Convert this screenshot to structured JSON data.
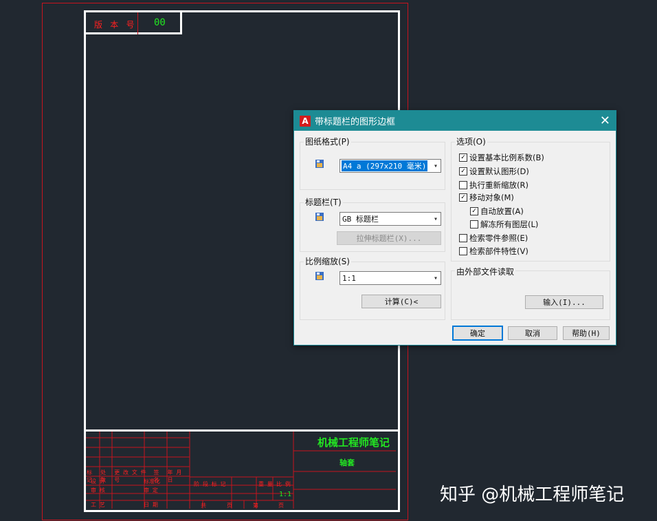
{
  "drawing": {
    "version_label": "版 本 号",
    "version_value": "00",
    "company": "机械工程师笔记",
    "part_name": "轴套",
    "scale_value": "1:1",
    "row1_labels": [
      "标 记",
      "处 数",
      "更 改 文 件 号",
      "签 名",
      "年 月 日"
    ],
    "row2_labels": [
      "设 计",
      "标准化"
    ],
    "row3_labels": [
      "审 核",
      "审 定"
    ],
    "row4_labels": [
      "工 艺",
      "日 期"
    ],
    "stage_headers": [
      "阶 段 标 记",
      "重 量",
      "比 例"
    ],
    "bottom_labels": [
      "共",
      "页",
      "第",
      "页"
    ]
  },
  "watermark": "知乎 @机械工程师笔记",
  "dialog": {
    "title": "带标题栏的图形边框",
    "close_glyph": "✕",
    "paper_format": {
      "label": "图纸格式(P)",
      "value": "A4 a (297x210 毫米)"
    },
    "title_block": {
      "label": "标题栏(T)",
      "value": "GB 标题栏",
      "stretch_button": "拉伸标题栏(X)..."
    },
    "scale": {
      "label": "比例缩放(S)",
      "value": "1:1",
      "calc_button": "计算(C)<"
    },
    "options": {
      "label": "选项(O)",
      "items": [
        {
          "label": "设置基本比例系数(B)",
          "checked": true
        },
        {
          "label": "设置默认图形(D)",
          "checked": true
        },
        {
          "label": "执行重新缩放(R)",
          "checked": false
        },
        {
          "label": "移动对象(M)",
          "checked": true
        },
        {
          "label": "自动放置(A)",
          "checked": true
        },
        {
          "label": "解冻所有图层(L)",
          "checked": false
        },
        {
          "label": "检索零件参照(E)",
          "checked": false
        },
        {
          "label": "检索部件特性(V)",
          "checked": false
        }
      ]
    },
    "external": {
      "label": "由外部文件读取",
      "import_button": "输入(I)..."
    },
    "ok_button": "确定",
    "cancel_button": "取消",
    "help_button": "帮助(H)"
  }
}
